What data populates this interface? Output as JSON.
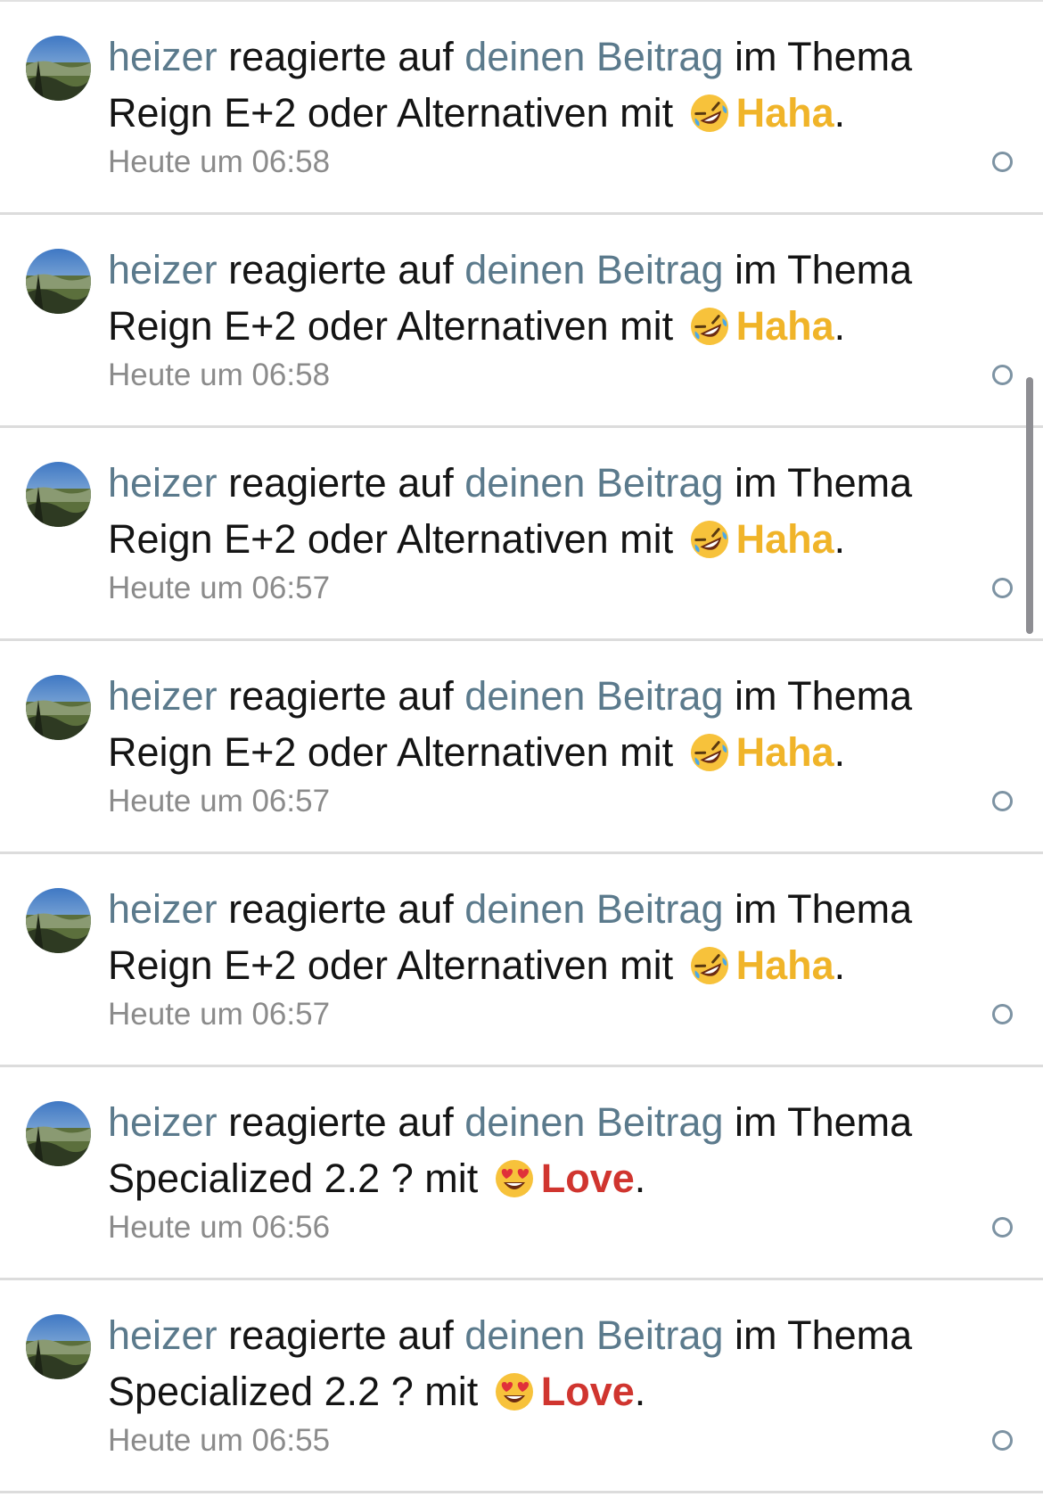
{
  "notifications": [
    {
      "user": "heizer",
      "action": " reagierte auf ",
      "link": "deinen Beitrag",
      "context": " im Thema",
      "topic": "Reign E+2 oder Alternativen",
      "with": " mit ",
      "reaction": "Haha",
      "reaction_type": "haha",
      "end": ".",
      "time": "Heute um 06:58"
    },
    {
      "user": "heizer",
      "action": " reagierte auf ",
      "link": "deinen Beitrag",
      "context": " im Thema",
      "topic": "Reign E+2 oder Alternativen",
      "with": " mit ",
      "reaction": "Haha",
      "reaction_type": "haha",
      "end": ".",
      "time": "Heute um 06:58"
    },
    {
      "user": "heizer",
      "action": " reagierte auf ",
      "link": "deinen Beitrag",
      "context": " im Thema",
      "topic": "Reign E+2 oder Alternativen",
      "with": " mit ",
      "reaction": "Haha",
      "reaction_type": "haha",
      "end": ".",
      "time": "Heute um 06:57"
    },
    {
      "user": "heizer",
      "action": " reagierte auf ",
      "link": "deinen Beitrag",
      "context": " im Thema",
      "topic": "Reign E+2 oder Alternativen",
      "with": " mit ",
      "reaction": "Haha",
      "reaction_type": "haha",
      "end": ".",
      "time": "Heute um 06:57"
    },
    {
      "user": "heizer",
      "action": " reagierte auf ",
      "link": "deinen Beitrag",
      "context": " im Thema",
      "topic": "Reign E+2 oder Alternativen",
      "with": " mit ",
      "reaction": "Haha",
      "reaction_type": "haha",
      "end": ".",
      "time": "Heute um 06:57"
    },
    {
      "user": "heizer",
      "action": " reagierte auf ",
      "link": "deinen Beitrag",
      "context": " im Thema",
      "topic": "Specialized 2.2 ?",
      "with": " mit ",
      "reaction": "Love",
      "reaction_type": "love",
      "end": ".",
      "time": "Heute um 06:56"
    },
    {
      "user": "heizer",
      "action": " reagierte auf ",
      "link": "deinen Beitrag",
      "context": " im Thema",
      "topic": "Specialized 2.2 ?",
      "with": " mit ",
      "reaction": "Love",
      "reaction_type": "love",
      "end": ".",
      "time": "Heute um 06:55"
    }
  ],
  "icons": {
    "haha": "rolling-on-floor-laughing-emoji",
    "love": "heart-eyes-emoji",
    "mark_read": "unread-circle-icon"
  },
  "colors": {
    "link": "#5b7a8c",
    "haha": "#f0b429",
    "love": "#d0352f",
    "timestamp": "#8b8b8b"
  }
}
